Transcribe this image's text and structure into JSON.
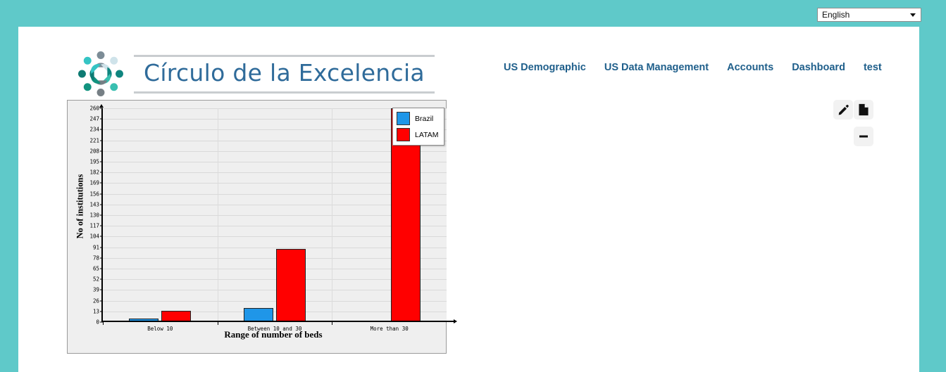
{
  "language_bar": {
    "select_value": "English",
    "options": [
      "English"
    ],
    "arrow_icon": "chevron-down-icon"
  },
  "header": {
    "logo_icon": "circle-of-people-logo",
    "title": "Círculo de la Excelencia",
    "nav": [
      {
        "label": "US Demographic"
      },
      {
        "label": "US Data Management"
      },
      {
        "label": "Accounts"
      },
      {
        "label": "Dashboard"
      },
      {
        "label": "test"
      }
    ]
  },
  "actions": [
    {
      "name": "edit-button",
      "icon": "pencil-icon"
    },
    {
      "name": "export-button",
      "icon": "document-icon"
    },
    {
      "name": "collapse-button",
      "icon": "minus-icon"
    }
  ],
  "colors": {
    "page_background": "#5fc9c9",
    "panel_background": "#ffffff",
    "brand_text": "#2f6b9a",
    "nav_link": "#1f5f8b",
    "chart_background": "#efefef",
    "series_brazil": "#1f96e8",
    "series_latam": "#ff0000"
  },
  "chart_data": {
    "type": "bar",
    "title": "",
    "xlabel": "Range of number of beds",
    "ylabel": "No of institutions",
    "categories": [
      "Below 10",
      "Between 10 and 30",
      "More than 30"
    ],
    "series": [
      {
        "name": "Brazil",
        "color": "#1f96e8",
        "values": [
          4,
          17,
          0
        ]
      },
      {
        "name": "LATAM",
        "color": "#ff0000",
        "values": [
          14,
          89,
          260
        ]
      }
    ],
    "ylim": [
      0,
      260
    ],
    "yticks": [
      0,
      13,
      26,
      39,
      52,
      65,
      78,
      91,
      104,
      117,
      130,
      143,
      156,
      169,
      182,
      195,
      208,
      221,
      234,
      247,
      260
    ],
    "grid": true,
    "legend_position": "top-right",
    "legend": [
      "Brazil",
      "LATAM"
    ]
  }
}
